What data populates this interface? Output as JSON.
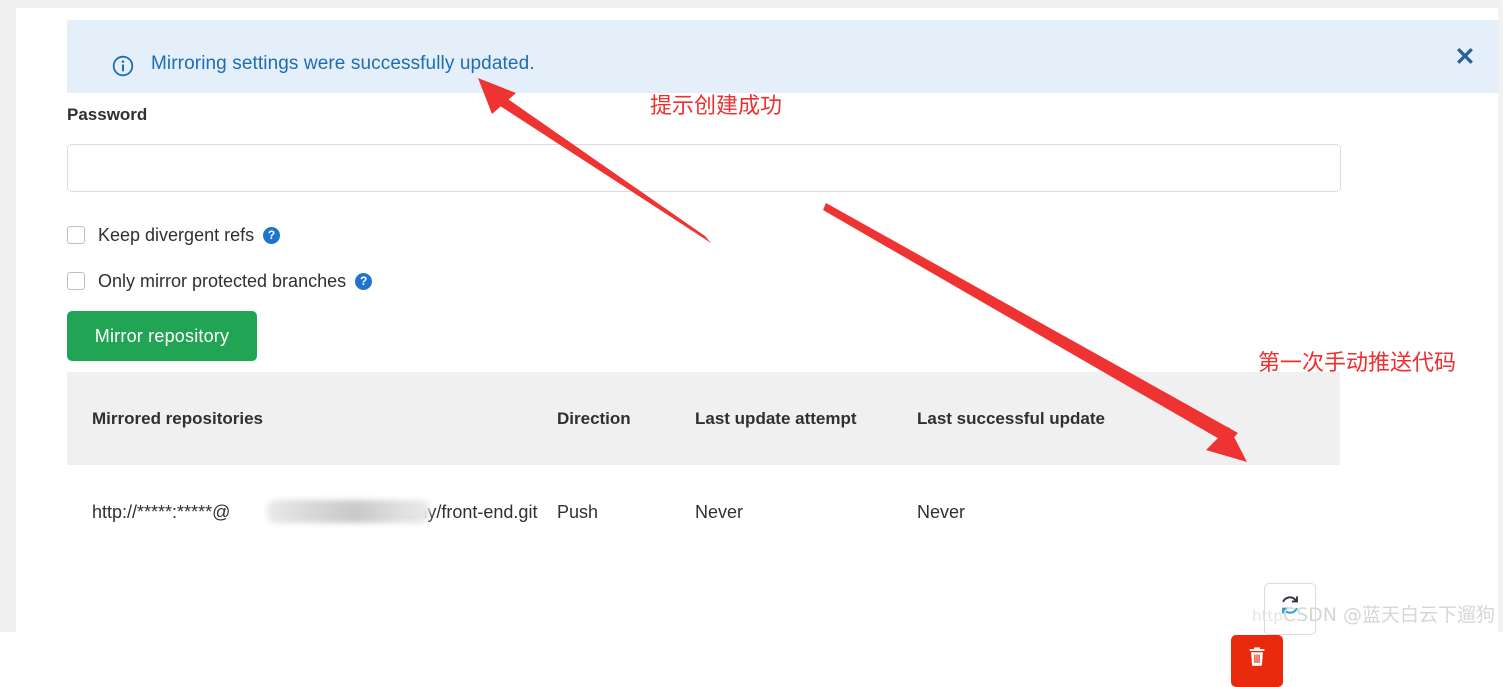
{
  "alert": {
    "icon": "info-circle-icon",
    "message": "Mirroring settings were successfully updated.",
    "close_icon": "close-icon",
    "background_color": "#e4effa",
    "text_color": "#1f6cb2"
  },
  "form": {
    "password_label": "Password",
    "password_value": "",
    "password_placeholder": "",
    "checkboxes": [
      {
        "label": "Keep divergent refs",
        "checked": false,
        "help_icon": "question-circle-icon"
      },
      {
        "label": "Only mirror protected branches",
        "checked": false,
        "help_icon": "question-circle-icon"
      }
    ],
    "submit_label": "Mirror repository",
    "submit_color": "#21a453"
  },
  "table": {
    "headers": {
      "repo": "Mirrored repositories",
      "direction": "Direction",
      "last_attempt": "Last update attempt",
      "last_success": "Last successful update",
      "actions": ""
    },
    "rows": [
      {
        "repo_url": "http://*****:*****@",
        "repo_url_suffix": "/sany/front-end.git",
        "direction": "Push",
        "last_attempt": "Never",
        "last_success": "Never",
        "refresh_icon": "refresh-sync-icon",
        "delete_icon": "trash-icon",
        "delete_color": "#e8290b"
      }
    ]
  },
  "annotations": {
    "color": "#ef2e2e",
    "labels": [
      {
        "text": "提示创建成功"
      },
      {
        "text": "第一次手动推送代码"
      }
    ]
  },
  "watermark": {
    "prefix": "http",
    "text": "CSDN @蓝天白云下遛狗"
  }
}
